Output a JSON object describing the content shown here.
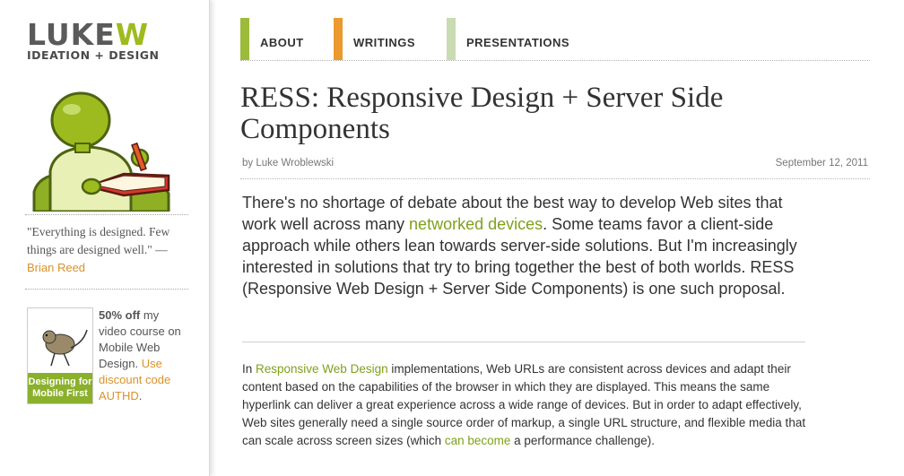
{
  "brand": {
    "logo_top": "LUKEW",
    "logo_bottom": "IDEATION + DESIGN"
  },
  "sidebar": {
    "quote_text": "\"Everything is designed. Few things are designed well.\" —",
    "quote_author": "Brian Reed",
    "book_title": "Designing for Mobile First",
    "promo": {
      "bold": "50% off",
      "text1": " my video course on Mobile Web Design. ",
      "link": "Use discount code AUTHD",
      "text2": "."
    }
  },
  "nav": {
    "items": [
      {
        "label": "ABOUT",
        "color": "#9dbb3a"
      },
      {
        "label": "WRITINGS",
        "color": "#ea9a2e"
      },
      {
        "label": "PRESENTATIONS",
        "color": "#c9dbb0"
      }
    ]
  },
  "article": {
    "title": "RESS: Responsive Design + Server Side Components",
    "byline": "by Luke Wroblewski",
    "date": "September 12, 2011",
    "lead_before": "There's no shortage of debate about the best way to develop Web sites that work well across many ",
    "lead_link": "networked devices",
    "lead_after": ". Some teams favor a client-side approach while others lean towards server-side solutions. But I'm increasingly interested in solutions that try to bring together the best of both worlds. RESS (Responsive Web Design + Server Side Components) is one such proposal.",
    "p1_before": "In ",
    "p1_link1": "Responsive Web Design",
    "p1_middle": " implementations, Web URLs are consistent across devices and adapt their content based on the capabilities of the browser in which they are displayed. This means the same hyperlink can deliver a great experience across a wide range of devices. But in order to adapt effectively, Web sites generally need a single source order of markup, a single URL structure, and flexible media that can scale across screen sizes (which ",
    "p1_link2": "can become",
    "p1_after": " a performance challenge)."
  },
  "colors": {
    "accent_green": "#7ea11b",
    "accent_orange": "#d9922a"
  }
}
